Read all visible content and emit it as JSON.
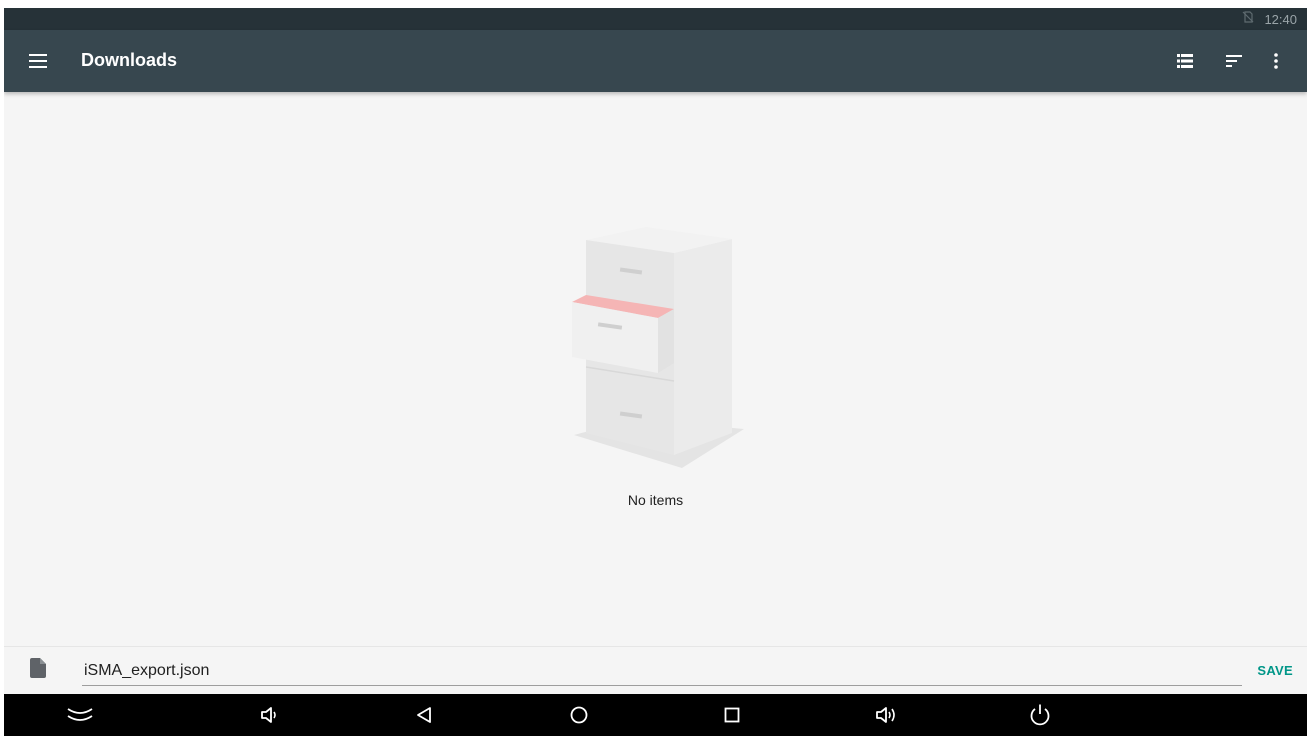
{
  "status_bar": {
    "time": "12:40"
  },
  "toolbar": {
    "title": "Downloads",
    "icons": {
      "menu": "menu-icon",
      "view": "list-view-icon",
      "sort": "sort-icon",
      "more": "more-vert-icon"
    }
  },
  "empty_state": {
    "message": "No items"
  },
  "save_bar": {
    "filename": "iSMA_export.json",
    "save_label": "SAVE"
  },
  "nav_bar": {
    "icons": [
      "hide-bar-icon",
      "volume-down-icon",
      "back-icon",
      "home-icon",
      "recents-icon",
      "volume-up-icon",
      "power-icon"
    ]
  },
  "colors": {
    "status_bar": "#263238",
    "toolbar": "#37474f",
    "background": "#f5f5f5",
    "accent": "#009688",
    "nav_bar": "#000000"
  }
}
